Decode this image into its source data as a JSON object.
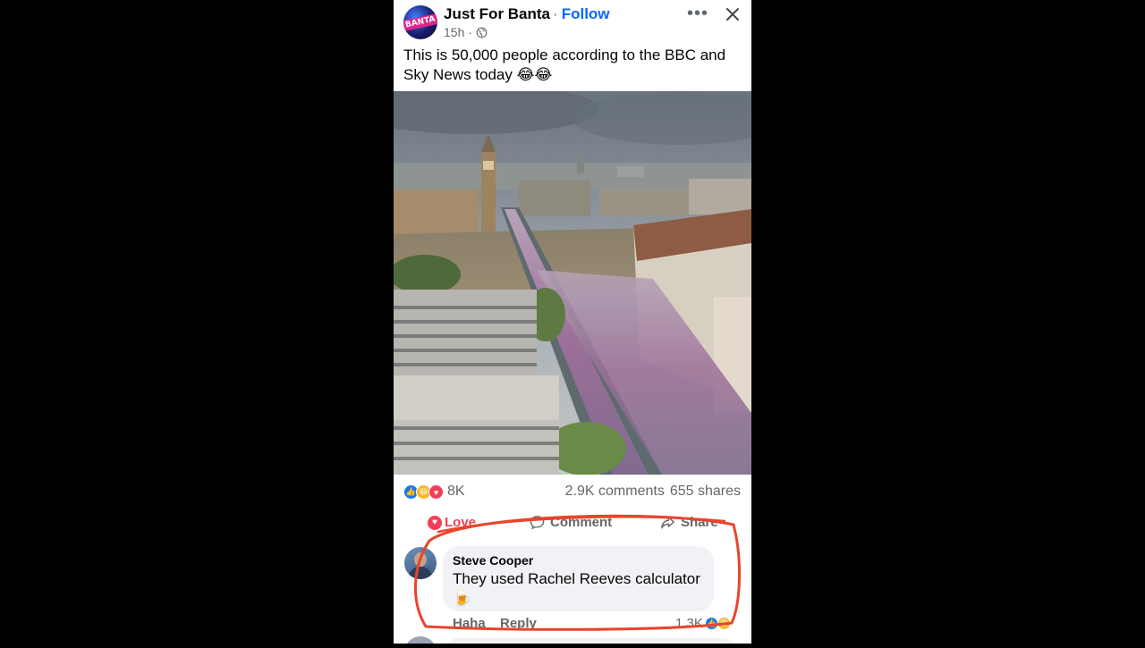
{
  "post": {
    "author": "Just For Banta",
    "follow_label": "Follow",
    "time": "15h",
    "caption": "This is 50,000 people according to the BBC and Sky News today 😂😂",
    "avatar_logo_text": "BANTA",
    "more_icon": "more-dots-icon",
    "close_icon": "close-icon"
  },
  "stats": {
    "reaction_icons": [
      "like-icon",
      "haha-icon",
      "love-icon"
    ],
    "reaction_count": "8K",
    "comments": "2.9K comments",
    "shares": "655 shares"
  },
  "actions": {
    "love": "Love",
    "comment": "Comment",
    "share": "Share"
  },
  "comment": {
    "author": "Steve Cooper",
    "text": "They used Rachel Reeves calculator 🍺",
    "haha_label": "Haha",
    "reply_label": "Reply",
    "reaction_count": "1.3K"
  },
  "colors": {
    "accent": "#0866ff",
    "love": "#f33e58",
    "annotation": "#e8452c"
  }
}
